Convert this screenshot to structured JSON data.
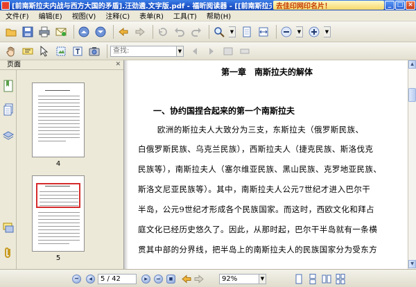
{
  "window": {
    "title": "[前南斯拉夫内战与西方大国的矛盾].汪劲遴.文字版.pdf - 福昕阅读器 - [[前南斯拉夫内战与西方大国的...",
    "banner": "去佳印网印名片！"
  },
  "menu": [
    "文件(F)",
    "编辑(E)",
    "视图(V)",
    "注释(C)",
    "表单(R)",
    "工具(T)",
    "帮助(H)"
  ],
  "toolbar2": {
    "search_placeholder": "查找:"
  },
  "panel": {
    "title": "页面",
    "close": "✕"
  },
  "thumbnails": [
    {
      "label": "4"
    },
    {
      "label": "5"
    }
  ],
  "document": {
    "chapter_title": "第一章　南斯拉夫的解体",
    "section_title": "一、协约国捏合起来的第一个南斯拉夫",
    "lines": [
      "　欧洲的斯拉夫人大致分为三支，东斯拉夫（俄罗斯民族、",
      "白俄罗斯民族、乌克兰民族），西斯拉夫人（捷克民族、斯洛伐克",
      "民族等），南斯拉夫人（塞尔维亚民族、黑山民族、克罗地亚民族、",
      "斯洛文尼亚民族等）。其中，南斯拉夫人公元7世纪才进入巴尔干",
      "半岛，公元9世纪才形成各个民族国家。而这时，西欧文化和拜占",
      "庭文化已经历史悠久了。因此，从那时起，巴尔干半岛就有一条横",
      "贯其中部的分界线，把半岛上的南斯拉夫人的民族国家分为受东方"
    ]
  },
  "status": {
    "page_value": "5 / 42",
    "zoom_value": "92%"
  }
}
